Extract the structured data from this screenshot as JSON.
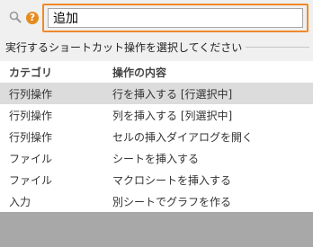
{
  "search": {
    "value": "追加",
    "search_icon": "search-icon",
    "help_icon": "help-icon",
    "help_label": "?"
  },
  "section": {
    "title": "実行するショートカット操作を選択してください"
  },
  "table": {
    "columns": [
      "カテゴリ",
      "操作の内容"
    ],
    "rows": [
      [
        "行列操作",
        "行を挿入する [行選択中]"
      ],
      [
        "行列操作",
        "列を挿入する [列選択中]"
      ],
      [
        "行列操作",
        "セルの挿入ダイアログを開く"
      ],
      [
        "ファイル",
        "シートを挿入する"
      ],
      [
        "ファイル",
        "マクロシートを挿入する"
      ],
      [
        "入力",
        "別シートでグラフを作る"
      ]
    ],
    "selected_row_index": 0
  },
  "colors": {
    "accent": "#f0892a",
    "help_icon": "#e88b1e",
    "selected_row": "#dcdcdc"
  }
}
